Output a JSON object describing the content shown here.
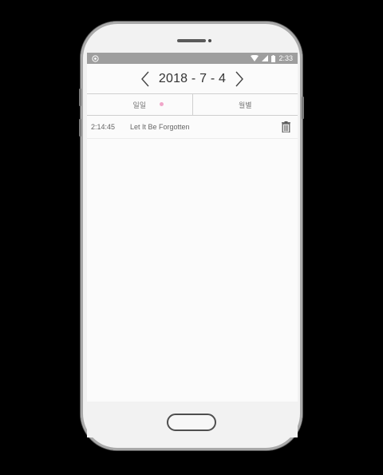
{
  "status_bar": {
    "notification_icon": "app-notification-icon",
    "icons": [
      "wifi-icon",
      "signal-icon",
      "battery-icon"
    ],
    "time": "2:33"
  },
  "date_nav": {
    "prev_icon": "chevron-left-icon",
    "date": "2018 - 7 - 4",
    "next_icon": "chevron-right-icon"
  },
  "tabs": [
    {
      "label": "일일",
      "active": true,
      "indicator_color": "#f0a6c9"
    },
    {
      "label": "월별",
      "active": false
    }
  ],
  "entries": [
    {
      "time": "2:14:45",
      "title": "Let It Be Forgotten",
      "action_icon": "trash-icon"
    }
  ],
  "colors": {
    "status_bar": "#9e9e9e",
    "screen_bg": "#fbfbfb",
    "indicator": "#f0a6c9"
  }
}
